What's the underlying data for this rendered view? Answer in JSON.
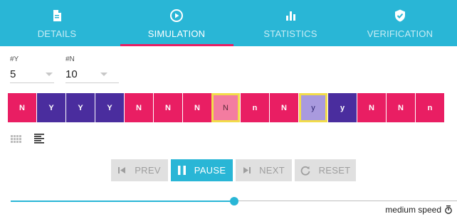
{
  "tabs": [
    {
      "label": "DETAILS",
      "icon": "document-icon",
      "active": false
    },
    {
      "label": "SIMULATION",
      "icon": "play-circle-icon",
      "active": true
    },
    {
      "label": "STATISTICS",
      "icon": "bar-chart-icon",
      "active": false
    },
    {
      "label": "VERIFICATION",
      "icon": "shield-check-icon",
      "active": false
    }
  ],
  "params": {
    "y_label": "#Y",
    "y_value": "5",
    "n_label": "#N",
    "n_value": "10"
  },
  "sequence": [
    {
      "text": "N",
      "style": "red"
    },
    {
      "text": "Y",
      "style": "purple"
    },
    {
      "text": "Y",
      "style": "purple"
    },
    {
      "text": "Y",
      "style": "purple"
    },
    {
      "text": "N",
      "style": "red"
    },
    {
      "text": "N",
      "style": "red"
    },
    {
      "text": "N",
      "style": "red"
    },
    {
      "text": "N",
      "style": "hl-red"
    },
    {
      "text": "n",
      "style": "red"
    },
    {
      "text": "N",
      "style": "red"
    },
    {
      "text": "y",
      "style": "hl-purple"
    },
    {
      "text": "y",
      "style": "purple"
    },
    {
      "text": "N",
      "style": "red"
    },
    {
      "text": "N",
      "style": "red"
    },
    {
      "text": "n",
      "style": "red"
    }
  ],
  "controls": {
    "prev_label": "PREV",
    "pause_label": "PAUSE",
    "next_label": "NEXT",
    "reset_label": "RESET"
  },
  "speed": {
    "label": "medium speed",
    "level": 0.5
  },
  "colors": {
    "accent": "#29b6d6",
    "tab_indicator": "#e91e63",
    "no_cell": "#e91e63",
    "yes_cell": "#4a2d9e",
    "highlight_border": "#f2dc4a"
  }
}
